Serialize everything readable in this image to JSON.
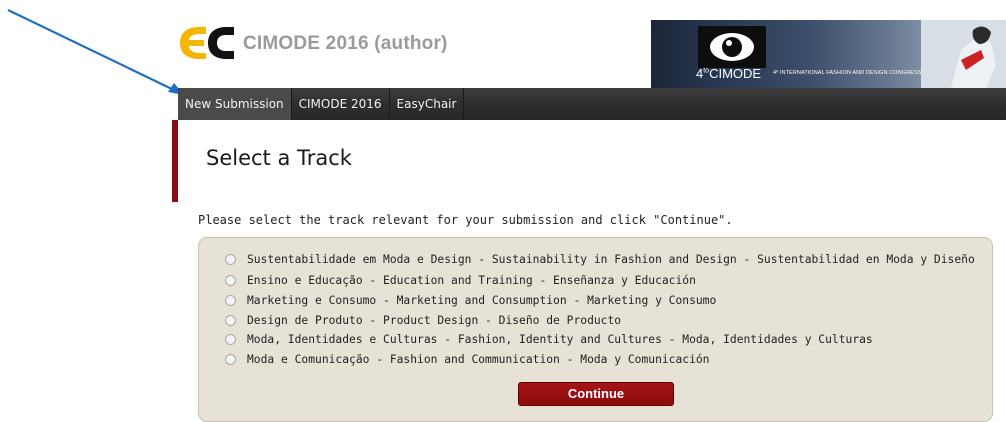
{
  "header": {
    "logo_text": "EC",
    "title": "CIMODE 2016 (author)",
    "banner": {
      "brand": "CIMODE",
      "brand_prefix": "4",
      "brand_sup": "to",
      "subtitle": "4º INTERNATIONAL FASHION AND DESIGN CONGRESS"
    }
  },
  "nav": {
    "items": [
      {
        "label": "New Submission"
      },
      {
        "label": "CIMODE 2016"
      },
      {
        "label": "EasyChair"
      }
    ]
  },
  "page": {
    "title": "Select a Track",
    "instructions": "Please select the track relevant for your submission and click \"Continue\"."
  },
  "tracks": [
    {
      "label": "Sustentabilidade em Moda e Design - Sustainability in Fashion and Design - Sustentabilidad en Moda y Diseño"
    },
    {
      "label": "Ensino e Educação - Education and Training - Enseñanza y Educación"
    },
    {
      "label": "Marketing e Consumo - Marketing and Consumption - Marketing y Consumo"
    },
    {
      "label": "Design de Produto - Product Design - Diseño de Producto"
    },
    {
      "label": "Moda, Identidades e Culturas - Fashion, Identity and Cultures - Moda, Identidades y Culturas"
    },
    {
      "label": "Moda e Comunicação - Fashion and Communication - Moda y Comunicación"
    }
  ],
  "actions": {
    "continue_label": "Continue"
  },
  "colors": {
    "accent": "#8c0a0d",
    "nav_bg": "#2e2e2e",
    "track_box_bg": "#e6e2d5",
    "arrow": "#1f6fc4",
    "logo_yellow": "#f2b705"
  }
}
